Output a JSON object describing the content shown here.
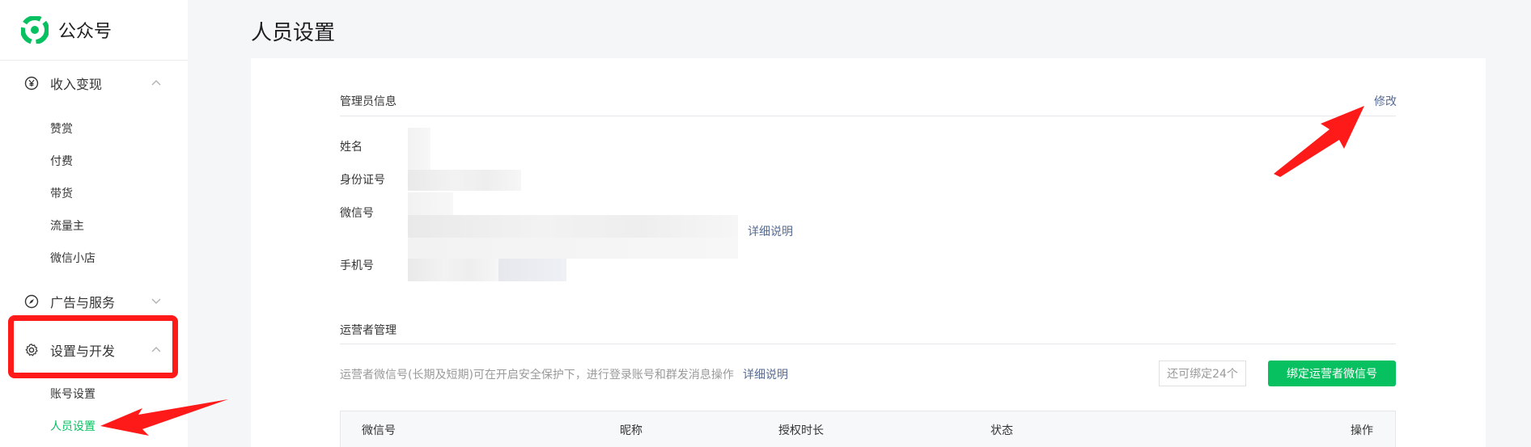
{
  "brand": {
    "name": "公众号",
    "color": "#07c160"
  },
  "sidebar": {
    "groups": [
      {
        "label": "收入变现",
        "icon": "yen-circle-icon",
        "expanded": true,
        "items": [
          "赞赏",
          "付费",
          "带货",
          "流量主",
          "微信小店"
        ]
      },
      {
        "label": "广告与服务",
        "icon": "compass-icon",
        "expanded": false,
        "items": []
      },
      {
        "label": "设置与开发",
        "icon": "gear-icon",
        "expanded": true,
        "items": [
          "账号设置",
          "人员设置"
        ]
      }
    ],
    "active_item": "人员设置"
  },
  "page": {
    "title": "人员设置",
    "admin": {
      "section_title": "管理员信息",
      "edit_link": "修改",
      "fields": {
        "name": "姓名",
        "id_number": "身份证号",
        "wechat": "微信号",
        "phone": "手机号"
      },
      "wechat_detail_link": "详细说明"
    },
    "operators": {
      "section_title": "运营者管理",
      "description": "运营者微信号(长期及短期)可在开启安全保护下，进行登录账号和群发消息操作",
      "detail_link": "详细说明",
      "remaining": "还可绑定24个",
      "bind_button": "绑定运营者微信号",
      "table_headers": [
        "微信号",
        "昵称",
        "授权时长",
        "状态",
        "操作"
      ]
    }
  },
  "annotations": {
    "highlight_color": "#ff1a1a"
  }
}
